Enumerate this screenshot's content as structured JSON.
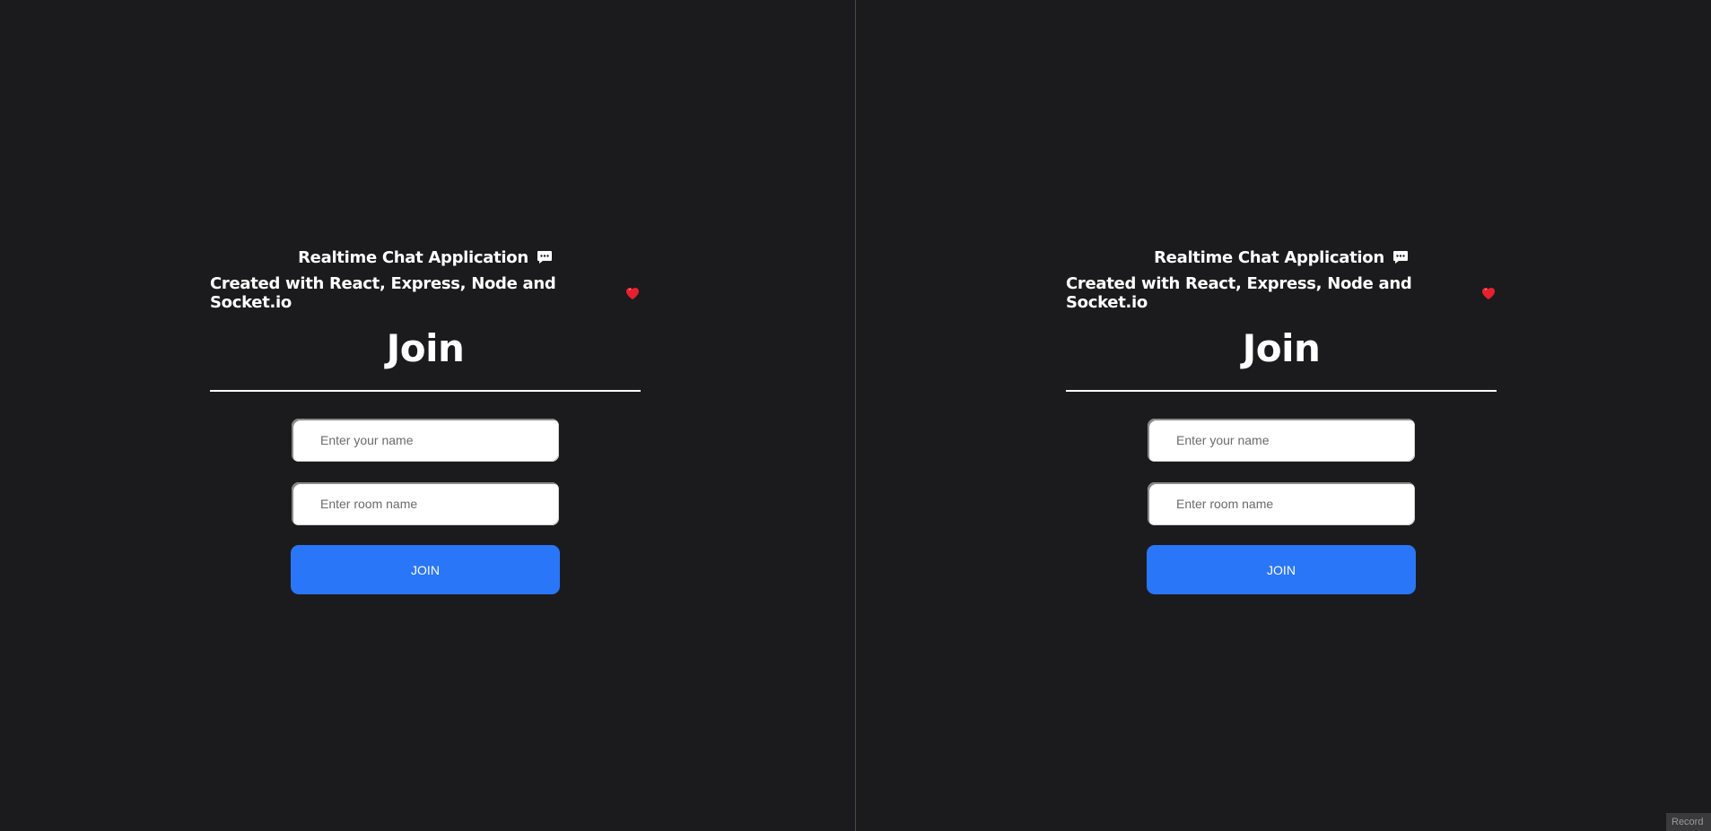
{
  "panes": [
    {
      "title": "Realtime Chat Application",
      "title_icon": "chat-bubble-icon",
      "subtitle": "Created with React, Express, Node and Socket.io",
      "subtitle_icon": "heart-icon",
      "heading": "Join",
      "name_placeholder": "Enter your name",
      "room_placeholder": "Enter room name",
      "join_label": "JOIN"
    },
    {
      "title": "Realtime Chat Application",
      "title_icon": "chat-bubble-icon",
      "subtitle": "Created with React, Express, Node and Socket.io",
      "subtitle_icon": "heart-icon",
      "heading": "Join",
      "name_placeholder": "Enter your name",
      "room_placeholder": "Enter room name",
      "join_label": "JOIN"
    }
  ],
  "corner_tag": "Record",
  "colors": {
    "background": "#1b1b1d",
    "button": "#2a76f8",
    "heart": "#e8202e"
  }
}
